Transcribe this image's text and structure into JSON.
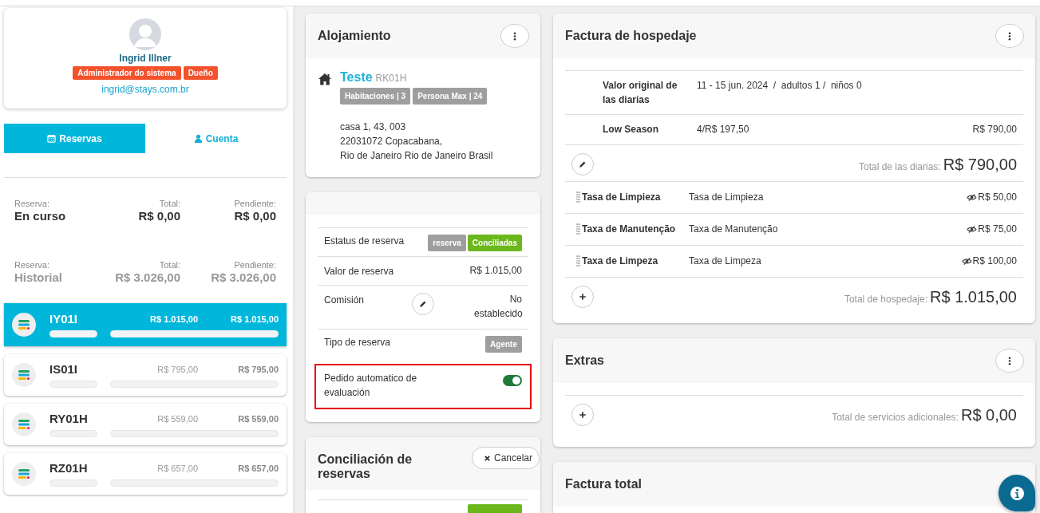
{
  "profile": {
    "name": "Ingrid Illner",
    "roles": [
      "Administrador do sistema",
      "Dueño"
    ],
    "email": "ingrid@stays.com.br"
  },
  "tabs": [
    {
      "label": "Reservas",
      "selected": true
    },
    {
      "label": "Cuenta",
      "selected": false
    }
  ],
  "summaries": [
    {
      "label": "Reserva:",
      "status": "En curso",
      "total_label": "Total:",
      "total": "R$ 0,00",
      "pending_label": "Pendiente:",
      "pending": "R$ 0,00",
      "muted": false
    },
    {
      "label": "Reserva:",
      "status": "Historial",
      "total_label": "Total:",
      "total": "R$ 3.026,00",
      "pending_label": "Pendiente:",
      "pending": "R$ 3.026,00",
      "muted": true
    }
  ],
  "reservations": [
    {
      "code": "IY01I",
      "total": "R$ 1.015,00",
      "pending": "R$ 1.015,00",
      "selected": true
    },
    {
      "code": "IS01I",
      "total": "R$ 795,00",
      "pending": "R$ 795,00",
      "selected": false
    },
    {
      "code": "RY01H",
      "total": "R$ 559,00",
      "pending": "R$ 559,00",
      "selected": false
    },
    {
      "code": "RZ01H",
      "total": "R$ 657,00",
      "pending": "R$ 657,00",
      "selected": false
    }
  ],
  "property_card": {
    "title": "Alojamiento",
    "name": "Teste",
    "code": "RK01H",
    "tags": [
      "Habitaciones | 3",
      "Persona Max | 24"
    ],
    "address_lines": [
      "casa 1, 43, 003",
      "22031072 Copacabana,",
      "Rio de Janeiro Rio de Janeiro Brasil"
    ]
  },
  "booking_card": {
    "rows": [
      {
        "kind": "tags",
        "label": "Estatus de reserva",
        "tags": [
          {
            "text": "reserva",
            "color": "#9e9e9e"
          },
          {
            "text": "Conciliadas",
            "color": "#6cb81c"
          }
        ]
      },
      {
        "kind": "value",
        "label": "Valor de reserva",
        "value": "R$ 1.015,00"
      },
      {
        "kind": "edit",
        "label": "Comisión",
        "value": "No establecido"
      },
      {
        "kind": "tags",
        "label": "Tipo de reserva",
        "tags": [
          {
            "text": "Agente",
            "color": "#9e9e9e"
          }
        ]
      },
      {
        "kind": "toggle",
        "label": "Pedido automatico de evaluación",
        "on": true,
        "highlighted": true
      }
    ]
  },
  "reconciliation_card": {
    "title": "Conciliación de reservas",
    "button": "Cancelar"
  },
  "lodging_invoice": {
    "title": "Factura de hospedaje",
    "rates": [
      {
        "label": "Valor original de las diarias",
        "detail": "11 - 15 jun. 2024  /  adultos 1 /  niños 0"
      },
      {
        "label": "Low Season",
        "detail": "4/R$ 197,50",
        "amount": "R$ 790,00"
      }
    ],
    "daily_total_label": "Total de las diarias:",
    "daily_total": "R$ 790,00",
    "fees": [
      {
        "name": "Tasa de Limpieza",
        "description": "Tasa de Limpieza",
        "amount": "R$ 50,00"
      },
      {
        "name": "Taxa de Manutenção",
        "description": "Taxa de Manutenção",
        "amount": "R$ 75,00"
      },
      {
        "name": "Taxa de Limpeza",
        "description": "Taxa de Limpeza",
        "amount": "R$ 100,00"
      }
    ],
    "total_label": "Total de hospedaje:",
    "total": "R$ 1.015,00"
  },
  "extras": {
    "title": "Extras",
    "total_label": "Total de servicios adicionales:",
    "total": "R$ 0,00"
  },
  "total_invoice": {
    "title": "Factura total"
  }
}
